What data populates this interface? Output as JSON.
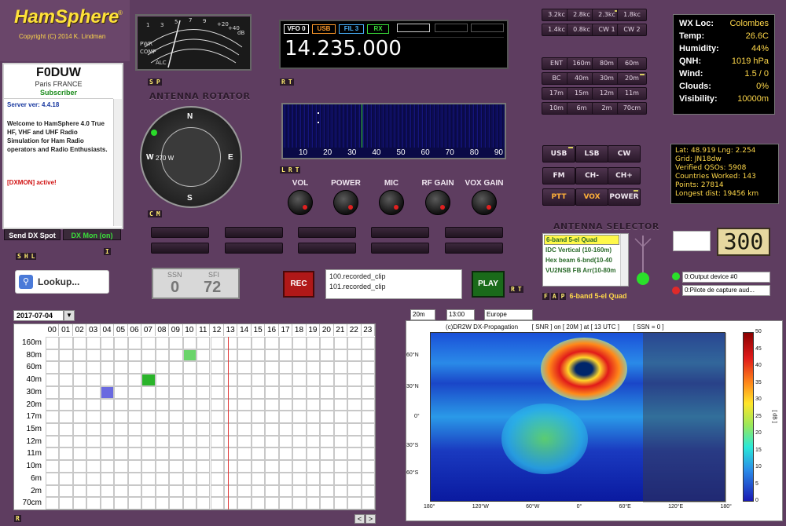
{
  "app": {
    "title": "HamSphere",
    "version_sup": "®",
    "copyright": "Copyright (C) 2014 K. Lindman"
  },
  "user": {
    "callsign": "F0DUW",
    "location": "Paris FRANCE",
    "status": "Subscriber",
    "server": "Server ver: 4.4.18",
    "welcome": "Welcome to HamSphere 4.0 True HF, VHF and UHF Radio Simulation for Ham Radio operators and Radio Enthusiasts.",
    "dxmon": "[DXMON] active!",
    "send_dx": "Send DX Spot",
    "dx_mon": "DX Mon (on)",
    "tags": [
      "S",
      "H",
      "L"
    ],
    "tag_i": "I"
  },
  "smeter": {
    "tags": [
      "S",
      "P"
    ],
    "scale": [
      "1",
      "3",
      "5",
      "7",
      "9",
      "+20",
      "+40",
      "dB"
    ],
    "labels": [
      "PWR",
      "COMP",
      "ALC"
    ]
  },
  "rotator": {
    "title": "ANTENNA ROTATOR",
    "bearing": "270 W",
    "tags": [
      "C",
      "M"
    ],
    "n": "N",
    "e": "E",
    "s": "S",
    "w": "W"
  },
  "vfo": {
    "name": "VFO 0",
    "mode": "USB",
    "filter": "FIL 3",
    "state": "RX",
    "frequency": "14.235.000",
    "tags": [
      "R",
      "T"
    ]
  },
  "waterfall": {
    "scale": [
      "10",
      "20",
      "30",
      "40",
      "50",
      "60",
      "70",
      "80",
      "90"
    ],
    "tags": [
      "L",
      "R",
      "T"
    ]
  },
  "knobs": [
    "VOL",
    "POWER",
    "MIC",
    "RF GAIN",
    "VOX GAIN"
  ],
  "filters": [
    "3.2kc",
    "2.8kc",
    "2.3kc",
    "1.8kc",
    "1.4kc",
    "0.8kc",
    "CW 1",
    "CW 2"
  ],
  "bands": [
    "ENT",
    "160m",
    "80m",
    "60m",
    "BC",
    "40m",
    "30m",
    "20m",
    "17m",
    "15m",
    "12m",
    "11m",
    "10m",
    "6m",
    "2m",
    "70cm"
  ],
  "modes": [
    "USB",
    "LSB",
    "CW",
    "FM",
    "CH-",
    "CH+",
    "PTT",
    "VOX",
    "POWER"
  ],
  "weather": [
    {
      "k": "WX Loc:",
      "v": "Colombes"
    },
    {
      "k": "Temp:",
      "v": "26.6C"
    },
    {
      "k": "Humidity:",
      "v": "44%"
    },
    {
      "k": "QNH:",
      "v": "1019 hPa"
    },
    {
      "k": "Wind:",
      "v": "1.5 / 0"
    },
    {
      "k": "Clouds:",
      "v": "0%"
    },
    {
      "k": "Visibility:",
      "v": "10000m"
    }
  ],
  "station": [
    "Lat: 48.919 Lng: 2.254",
    "Grid: JN18dw",
    "Verified QSOs: 5908",
    "Countries Worked: 143",
    "Points: 27814",
    "Longest dist: 19456 km"
  ],
  "antenna_selector": {
    "title": "ANTENNA SELECTOR",
    "items": [
      "6-band 5-el Quad",
      "IDC Vertical (10-160m)",
      "Hex beam 6-bnd(10-40",
      "VU2NSB FB Arr(10-80m"
    ],
    "current": "6-band 5-el Quad",
    "tags": [
      "F",
      "A",
      "P"
    ]
  },
  "counter": "300",
  "lookup": {
    "label": "Lookup..."
  },
  "ssn": {
    "ssn_label": "SSN",
    "sfi_label": "SFI",
    "ssn": "0",
    "sfi": "72"
  },
  "recorder": {
    "rec": "REC",
    "play": "PLAY",
    "clips": [
      "100.recorded_clip",
      "101.recorded_clip"
    ],
    "tags": [
      "R",
      "T"
    ]
  },
  "audio": {
    "output": "0:Output device #0",
    "input": "0:Pilote de capture aud..."
  },
  "propgrid": {
    "date": "2017-07-04",
    "hours": [
      "00",
      "01",
      "02",
      "03",
      "04",
      "05",
      "06",
      "07",
      "08",
      "09",
      "10",
      "11",
      "12",
      "13",
      "14",
      "15",
      "16",
      "17",
      "18",
      "19",
      "20",
      "21",
      "22",
      "23"
    ],
    "bands": [
      "160m",
      "80m",
      "60m",
      "40m",
      "30m",
      "20m",
      "17m",
      "15m",
      "12m",
      "11m",
      "10m",
      "6m",
      "2m",
      "70cm"
    ],
    "nav_prev": "<",
    "nav_next": ">",
    "tag": "R"
  },
  "propmap": {
    "band": "20m",
    "time": "13:00",
    "region": "Europe",
    "title": "(c)DR2W DX-Propagation        [ SNR ] on [ 20M ] at [ 13 UTC ]        [ SSN = 0 ]",
    "lat_labels": [
      "60°N",
      "30°N",
      "0°",
      "30°S",
      "60°S"
    ],
    "lon_labels": [
      "180°",
      "120°W",
      "60°W",
      "0°",
      "60°E",
      "120°E",
      "180°"
    ],
    "colorbar": [
      "50",
      "45",
      "40",
      "35",
      "30",
      "25",
      "20",
      "15",
      "10",
      "5",
      "0"
    ],
    "unit": "[ dB ]"
  }
}
